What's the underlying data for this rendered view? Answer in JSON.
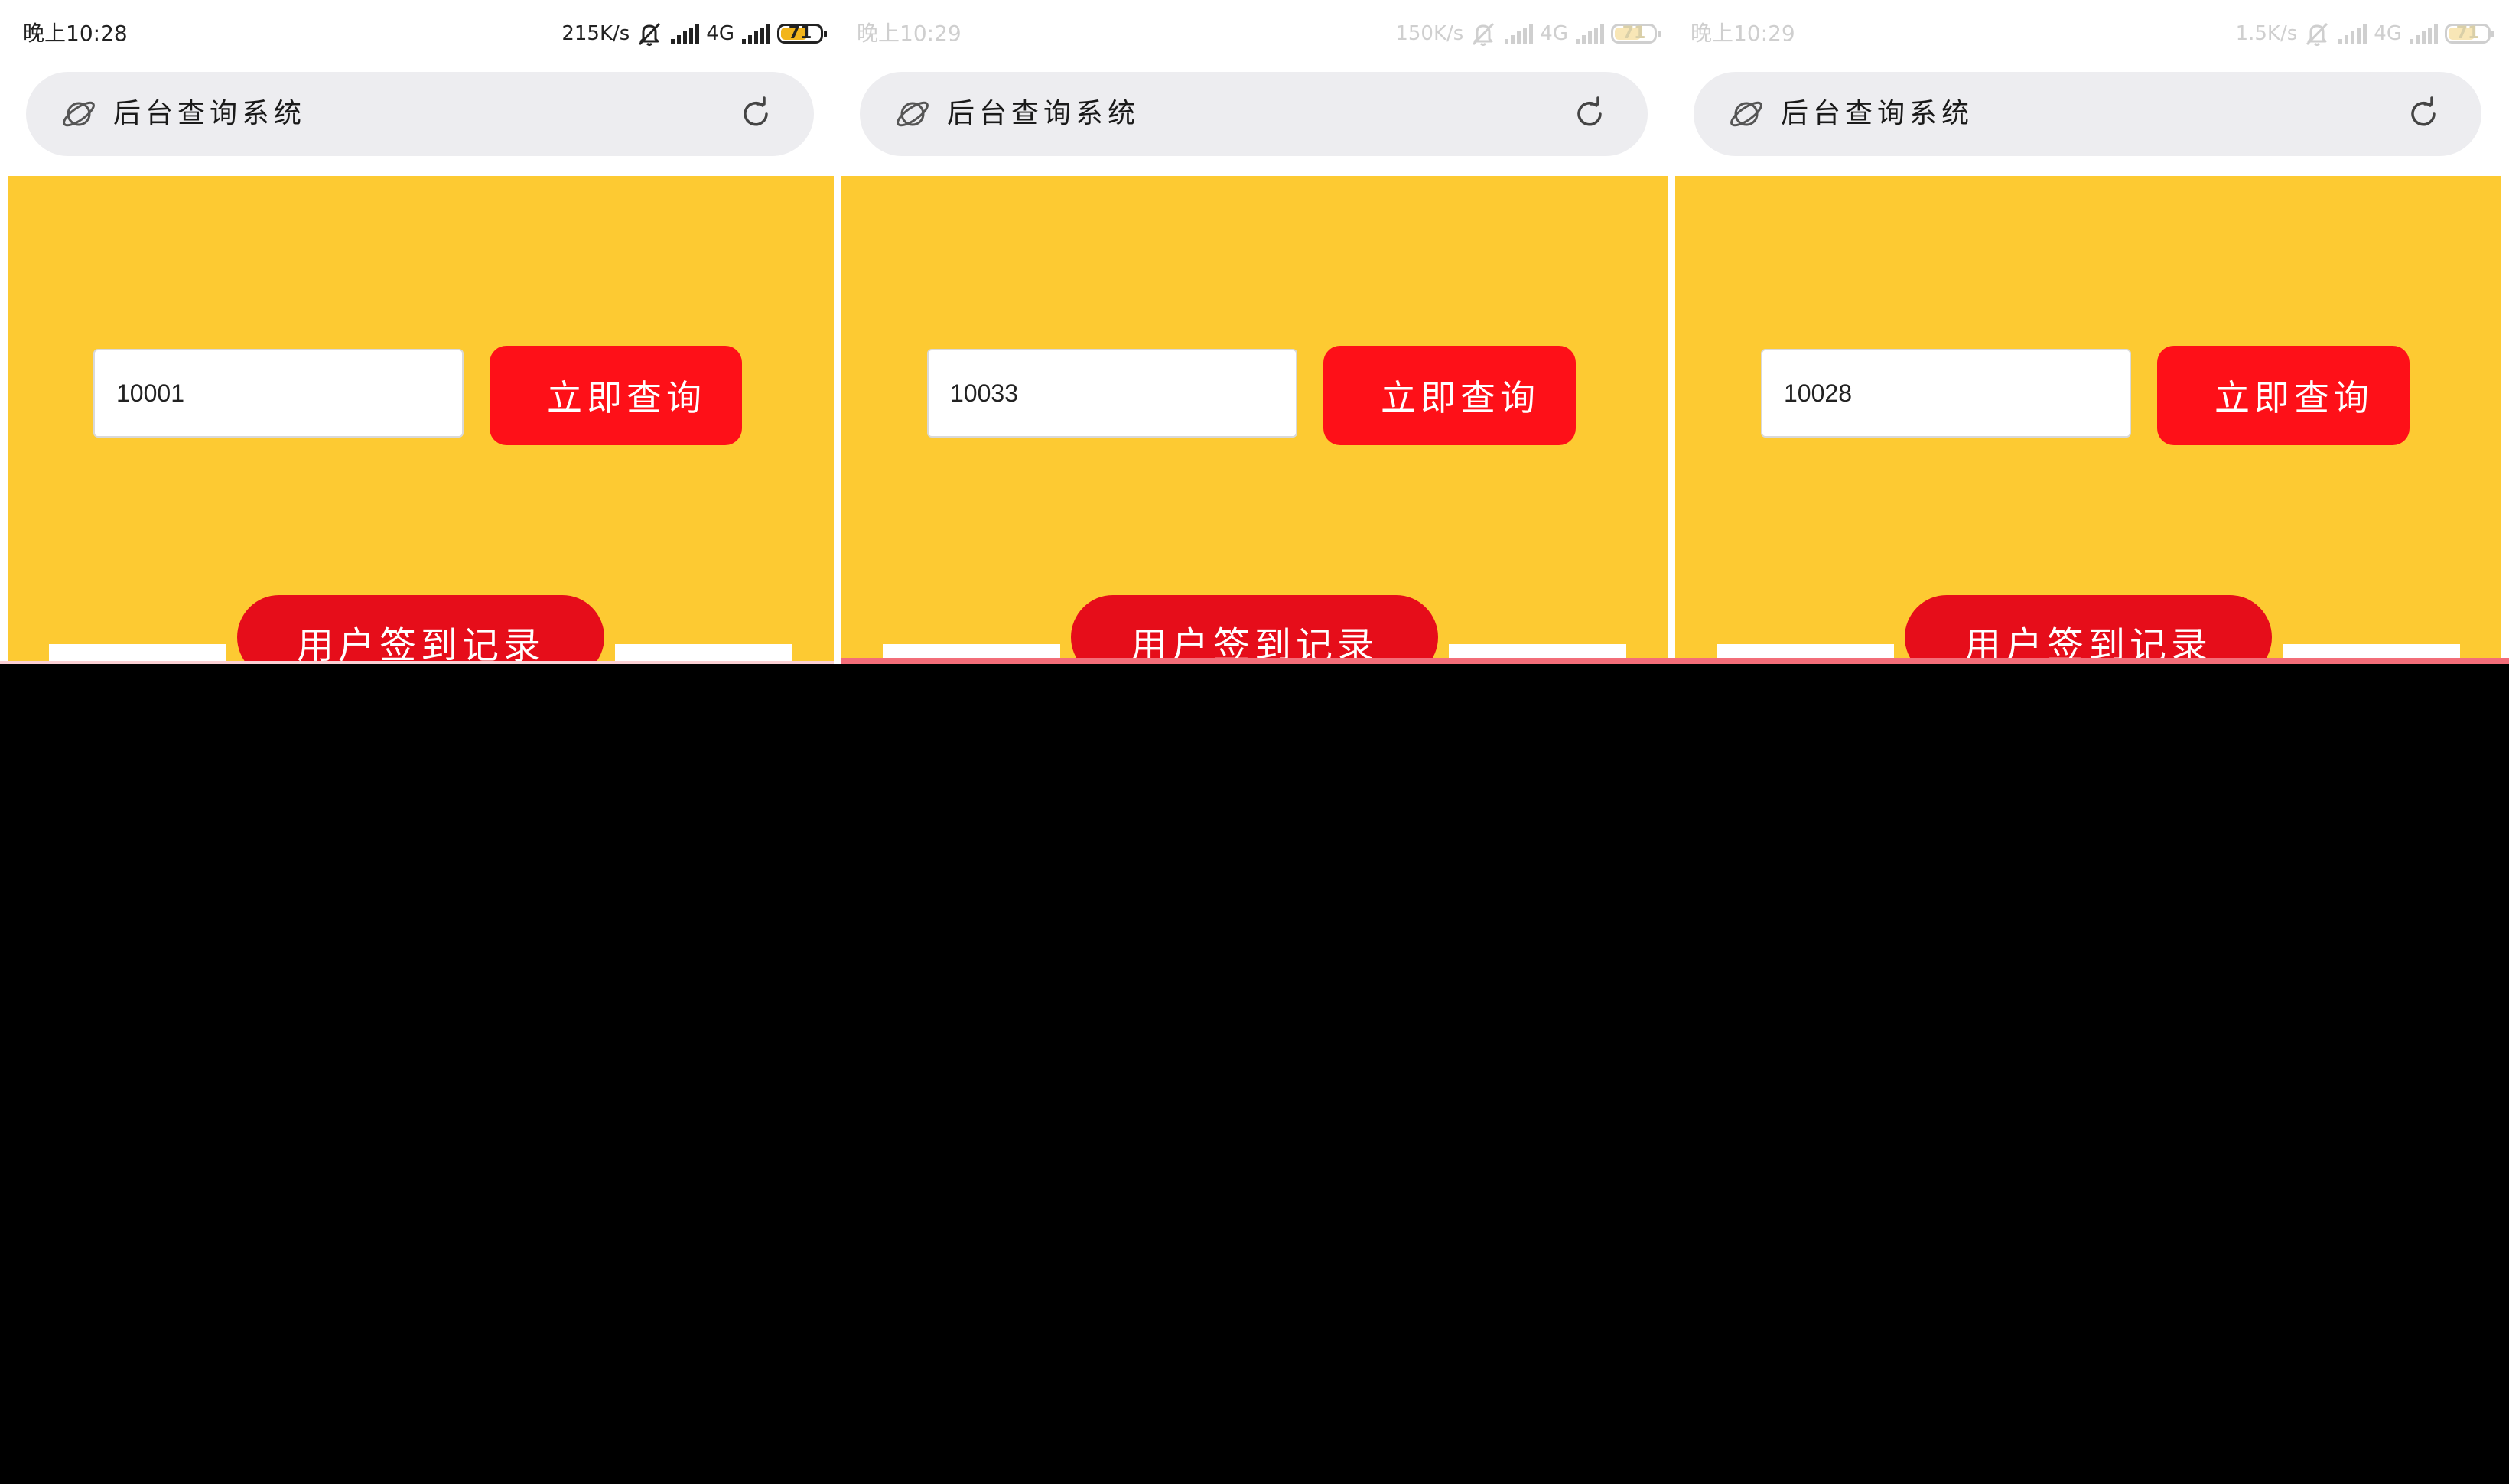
{
  "panels": [
    {
      "status": {
        "time": "晚上10:28",
        "speed": "215K/s",
        "network": "4G",
        "battery": "71",
        "battery_level": 0.71
      },
      "address_bar": {
        "title": "后台查询系统"
      },
      "query": {
        "input_value": "10001",
        "button_label": "立即查询"
      },
      "signin_label": "用户签到记录"
    },
    {
      "status": {
        "time": "晚上10:29",
        "speed": "150K/s",
        "network": "4G",
        "battery": "71",
        "battery_level": 0.71
      },
      "address_bar": {
        "title": "后台查询系统"
      },
      "query": {
        "input_value": "10033",
        "button_label": "立即查询"
      },
      "signin_label": "用户签到记录"
    },
    {
      "status": {
        "time": "晚上10:29",
        "speed": "1.5K/s",
        "network": "4G",
        "battery": "71",
        "battery_level": 0.71
      },
      "address_bar": {
        "title": "后台查询系统"
      },
      "query": {
        "input_value": "10028",
        "button_label": "立即查询"
      },
      "signin_label": "用户签到记录"
    }
  ],
  "icons": {
    "mute": "bell-off-icon",
    "signal": "signal-bars-icon",
    "site": "planet-icon",
    "reload": "reload-icon"
  },
  "colors": {
    "page_background": "#fdca32",
    "query_button": "#fe1018",
    "signin_button": "#e60d1a",
    "address_bar": "#ededf0",
    "divider": "#f36d79"
  }
}
